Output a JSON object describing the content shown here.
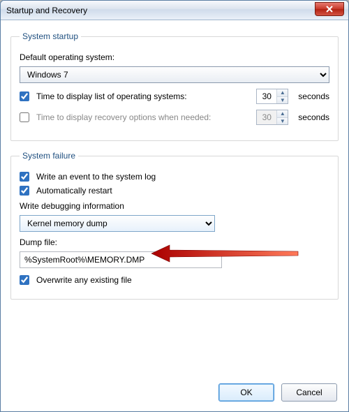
{
  "window": {
    "title": "Startup and Recovery"
  },
  "startup": {
    "legend": "System startup",
    "defaultOsLabel": "Default operating system:",
    "defaultOsValue": "Windows 7",
    "displayListLabel": "Time to display list of operating systems:",
    "displayListChecked": true,
    "displayListValue": "30",
    "displayListUnits": "seconds",
    "displayRecoveryLabel": "Time to display recovery options when needed:",
    "displayRecoveryChecked": false,
    "displayRecoveryValue": "30",
    "displayRecoveryUnits": "seconds"
  },
  "failure": {
    "legend": "System failure",
    "writeEventLabel": "Write an event to the system log",
    "writeEventChecked": true,
    "autoRestartLabel": "Automatically restart",
    "autoRestartChecked": true,
    "debugInfoLabel": "Write debugging information",
    "debugInfoValue": "Kernel memory dump",
    "dumpFileLabel": "Dump file:",
    "dumpFileValue": "%SystemRoot%\\MEMORY.DMP",
    "overwriteLabel": "Overwrite any existing file",
    "overwriteChecked": true
  },
  "buttons": {
    "ok": "OK",
    "cancel": "Cancel"
  }
}
